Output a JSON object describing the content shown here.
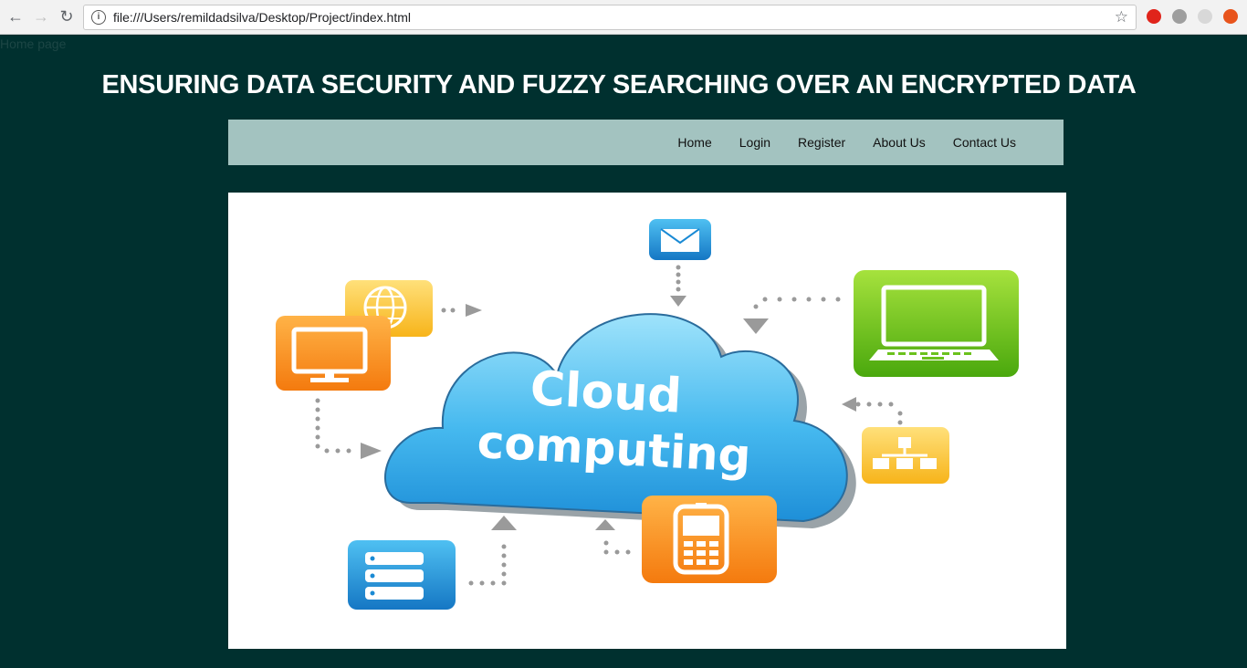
{
  "browser": {
    "url": "file:///Users/remildadsilva/Desktop/Project/index.html",
    "icons": {
      "back": "arrow-left-icon",
      "forward": "arrow-right-icon",
      "reload": "reload-icon",
      "info": "info-icon",
      "bookmark": "star-icon"
    }
  },
  "page": {
    "tab_label": "Home page",
    "title": "ENSURING DATA SECURITY AND FUZZY SEARCHING OVER AN ENCRYPTED DATA"
  },
  "nav": {
    "items": [
      {
        "label": "Home"
      },
      {
        "label": "Login"
      },
      {
        "label": "Register"
      },
      {
        "label": "About Us"
      },
      {
        "label": "Contact Us"
      }
    ]
  },
  "hero": {
    "cloud_line1": "Cloud",
    "cloud_line2": "computing"
  },
  "colors": {
    "background": "#00302f",
    "navbar": "#a3c3c0",
    "title": "#ffffff"
  }
}
